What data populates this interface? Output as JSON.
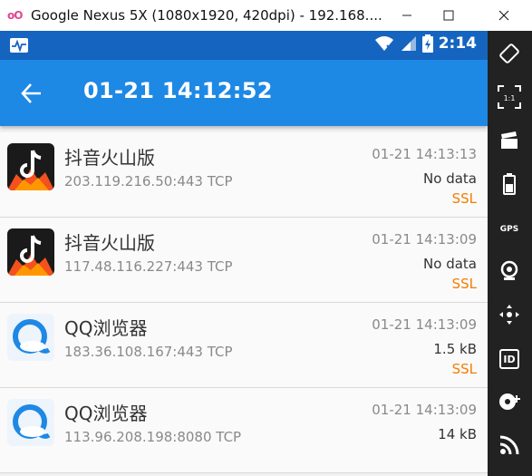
{
  "window": {
    "title": "Google Nexus 5X (1080x1920, 420dpi) - 192.168....",
    "logo_text": "oO"
  },
  "statusbar": {
    "time": "2:14"
  },
  "appbar": {
    "title": "01-21 14:12:52"
  },
  "connections": [
    {
      "app": "抖音火山版",
      "address": "203.119.216.50:443",
      "protocol": "TCP",
      "time": "01-21 14:13:13",
      "size": "No data",
      "ssl": "SSL",
      "icon": "douyin-huoshan-icon"
    },
    {
      "app": "抖音火山版",
      "address": "117.48.116.227:443",
      "protocol": "TCP",
      "time": "01-21 14:13:09",
      "size": "No data",
      "ssl": "SSL",
      "icon": "douyin-huoshan-icon"
    },
    {
      "app": "QQ浏览器",
      "address": "183.36.108.167:443",
      "protocol": "TCP",
      "time": "01-21 14:13:09",
      "size": "1.5 kB",
      "ssl": "SSL",
      "icon": "qq-browser-icon"
    },
    {
      "app": "QQ浏览器",
      "address": "113.96.208.198:8080",
      "protocol": "TCP",
      "time": "01-21 14:13:09",
      "size": "14 kB",
      "ssl": "",
      "icon": "qq-browser-icon"
    }
  ],
  "toolbar": {
    "scale_label": "1:1",
    "gps_label": "GPS",
    "id_label": "ID"
  },
  "colors": {
    "statusbar": "#1565c0",
    "appbar": "#1e88e5",
    "ssl": "#f57c00",
    "toolbar": "#222222"
  }
}
